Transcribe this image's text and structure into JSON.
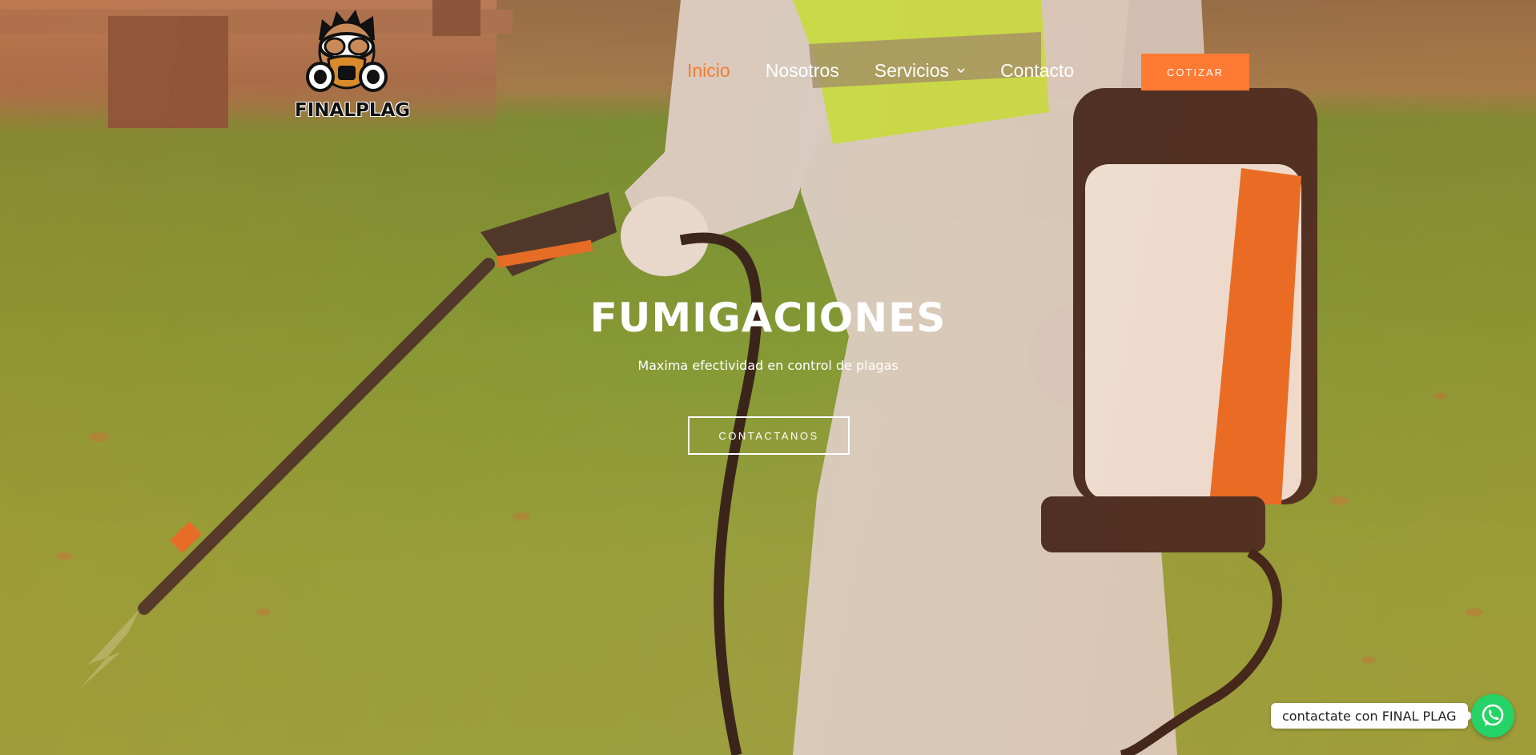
{
  "brand": {
    "logo_text": "FINALPLAG",
    "logo_icon": "gas-mask-mascot-icon"
  },
  "nav": {
    "items": [
      {
        "label": "Inicio",
        "active": true
      },
      {
        "label": "Nosotros",
        "active": false
      },
      {
        "label": "Servicios",
        "active": false,
        "has_dropdown": true
      },
      {
        "label": "Contacto",
        "active": false
      }
    ],
    "cta_label": "COTIZAR"
  },
  "hero": {
    "title": "FUMIGACIONES",
    "subtitle": "Maxima efectividad en control de plagas",
    "button_label": "CONTACTANOS"
  },
  "whatsapp": {
    "tooltip": "contactate con FINAL PLAG",
    "icon": "whatsapp-icon"
  },
  "colors": {
    "accent": "#ff7a33",
    "active_nav": "#f47c2f",
    "whatsapp": "#25d366"
  }
}
